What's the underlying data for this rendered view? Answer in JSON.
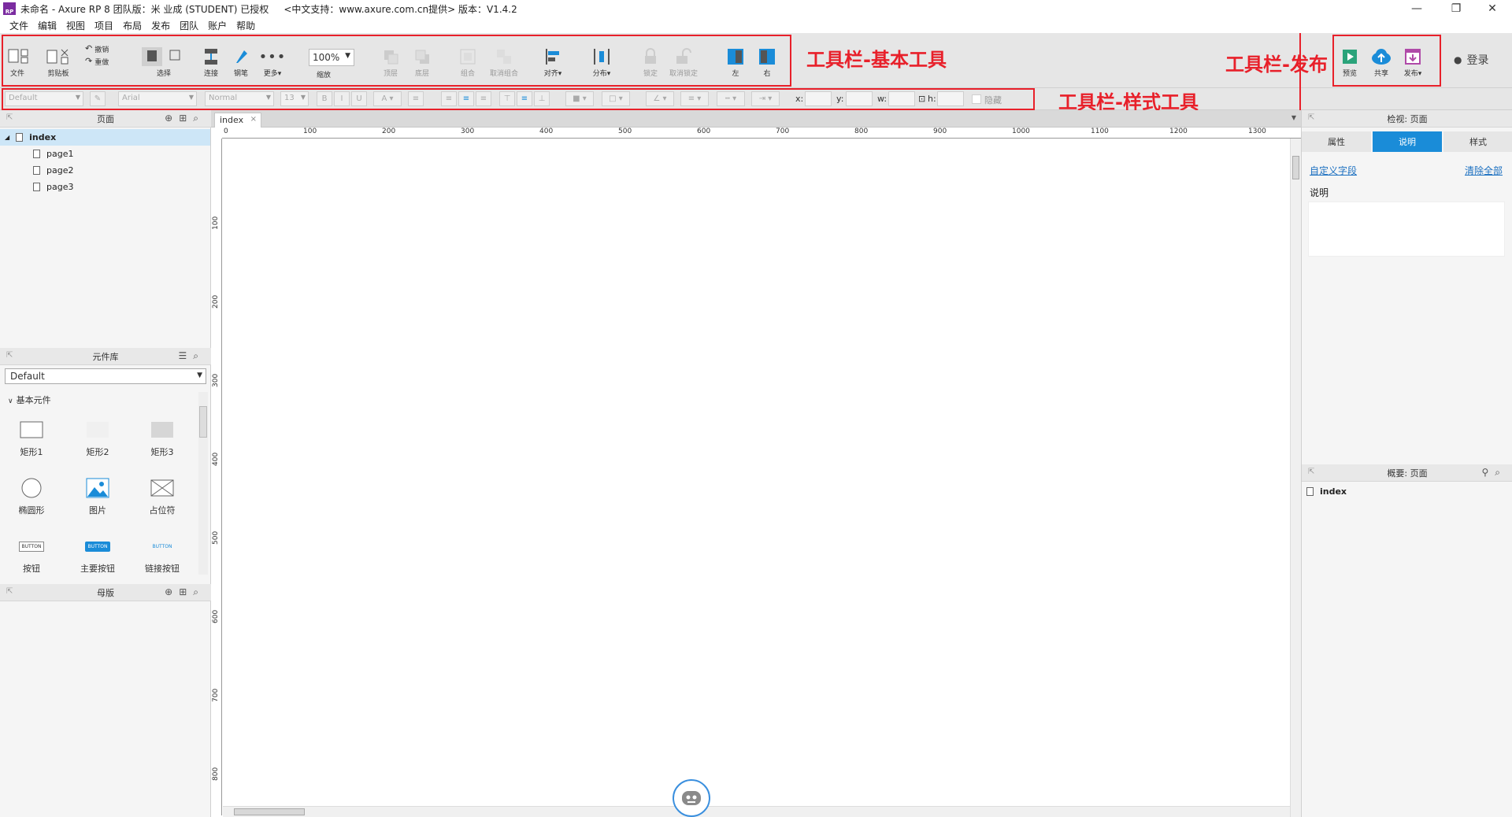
{
  "window": {
    "title": "未命名 - Axure RP 8 团队版：米 业成 (STUDENT) 已授权     <中文支持：www.axure.com.cn提供> 版本：V1.4.2",
    "logo_text": "RP",
    "minimize": "—",
    "maximize": "❐",
    "close": "✕"
  },
  "menu": [
    "文件",
    "编辑",
    "视图",
    "项目",
    "布局",
    "发布",
    "团队",
    "账户",
    "帮助"
  ],
  "toolbar": {
    "file": "文件",
    "clipboard": "剪贴板",
    "undo": "撤销",
    "redo": "重做",
    "select": "选择",
    "connect": "连接",
    "pen": "钢笔",
    "more": "更多▾",
    "zoom_value": "100%",
    "zoom_label": "缩放",
    "top": "顶层",
    "bottom": "底层",
    "group": "组合",
    "ungroup": "取消组合",
    "align": "对齐▾",
    "distribute": "分布▾",
    "lock": "锁定",
    "unlock": "取消锁定",
    "left": "左",
    "right": "右",
    "preview": "预览",
    "share": "共享",
    "publish": "发布▾",
    "login": "登录"
  },
  "annotations": {
    "basic": "工具栏-基本工具",
    "publish": "工具栏-发布",
    "style": "工具栏-样式工具"
  },
  "styletoolbar": {
    "style": "Default",
    "font": "Arial",
    "weight": "Normal",
    "size": "13",
    "x_label": "x:",
    "y_label": "y:",
    "w_label": "w:",
    "h_label": "h:",
    "hidden": "隐藏"
  },
  "pages_panel": {
    "title": "页面",
    "root": "index",
    "children": [
      "page1",
      "page2",
      "page3"
    ]
  },
  "library_panel": {
    "title": "元件库",
    "selected": "Default",
    "category": "基本元件",
    "widgets": [
      "矩形1",
      "矩形2",
      "矩形3",
      "椭圆形",
      "图片",
      "占位符",
      "按钮",
      "主要按钮",
      "链接按钮"
    ],
    "button_text": "BUTTON"
  },
  "masters_panel": {
    "title": "母版"
  },
  "canvas": {
    "tab": "index",
    "tab_close": "×",
    "hruler": [
      "0",
      "100",
      "200",
      "300",
      "400",
      "500",
      "600",
      "700",
      "800",
      "900",
      "1000",
      "1100",
      "1200",
      "1300"
    ],
    "vruler": [
      "100",
      "200",
      "300",
      "400",
      "500",
      "600",
      "700",
      "800"
    ]
  },
  "inspector": {
    "title": "检视: 页面",
    "tabs": [
      "属性",
      "说明",
      "样式"
    ],
    "active_tab": 1,
    "custom_fields": "自定义字段",
    "clear_all": "清除全部",
    "notes_label": "说明"
  },
  "outline": {
    "title": "概要: 页面",
    "item": "index"
  },
  "colors": {
    "accent": "#1a8cd8",
    "annotation": "#e8202a",
    "selected_row": "#cde6f7"
  }
}
